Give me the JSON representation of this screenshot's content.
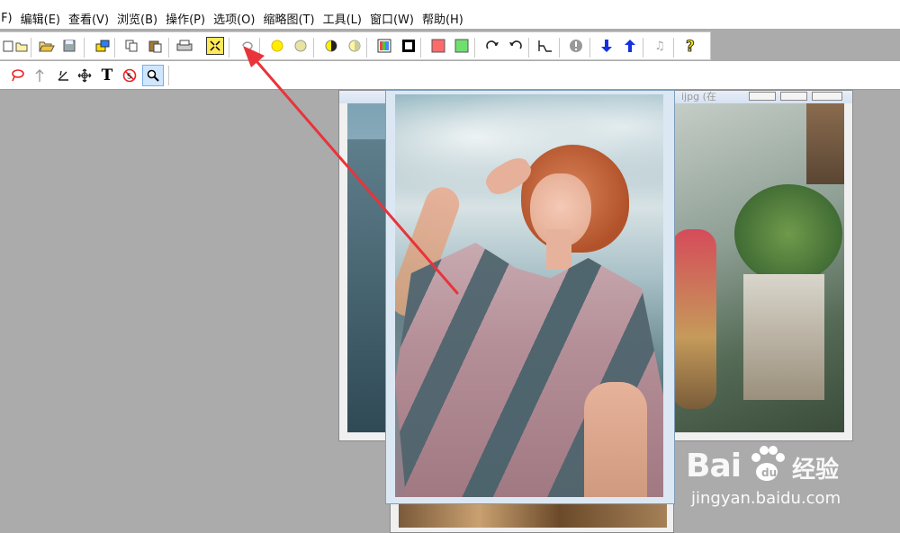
{
  "menu": [
    "(F)",
    "编辑(E)",
    "查看(V)",
    "浏览(B)",
    "操作(P)",
    "选项(O)",
    "缩略图(T)",
    "工具(L)",
    "窗口(W)",
    "帮助(H)"
  ],
  "toolbar1": [
    {
      "icon": "new-icon",
      "glyph": "▯"
    },
    {
      "icon": "folder-icon",
      "glyph": "🗀"
    },
    {
      "icon": "open-folder-icon",
      "glyph": "📂"
    },
    {
      "icon": "save-icon",
      "glyph": "💾"
    },
    {
      "icon": "color-pick-icon",
      "glyph": "🖌"
    },
    {
      "icon": "copy-icon",
      "glyph": "⧉"
    },
    {
      "icon": "paste-icon",
      "glyph": "📋"
    },
    {
      "icon": "print-icon",
      "glyph": "🖶"
    },
    {
      "icon": "fit-screen-icon",
      "glyph": "⛶"
    },
    {
      "icon": "lasso-icon",
      "glyph": "↶"
    },
    {
      "icon": "brightness-up-icon",
      "glyph": "☀"
    },
    {
      "icon": "brightness-down-icon",
      "glyph": "✺"
    },
    {
      "icon": "contrast-up-icon",
      "glyph": "◑"
    },
    {
      "icon": "contrast-down-icon",
      "glyph": "◐"
    },
    {
      "icon": "color-balance-icon",
      "glyph": "▦"
    },
    {
      "icon": "border-icon",
      "glyph": "▣"
    },
    {
      "icon": "red-fill-icon",
      "glyph": "■"
    },
    {
      "icon": "green-fill-icon",
      "glyph": "■"
    },
    {
      "icon": "rotate-right-icon",
      "glyph": "↷"
    },
    {
      "icon": "rotate-left-icon",
      "glyph": "↶"
    },
    {
      "icon": "histogram-icon",
      "glyph": "⊢"
    },
    {
      "icon": "info-icon",
      "glyph": "!"
    },
    {
      "icon": "arrow-down-icon",
      "glyph": "⬇"
    },
    {
      "icon": "arrow-up-icon",
      "glyph": "⬆"
    },
    {
      "icon": "music-icon",
      "glyph": "♫"
    },
    {
      "icon": "help-icon",
      "glyph": "?"
    }
  ],
  "toolbar2": [
    {
      "icon": "lasso-select-icon",
      "glyph": "ᑫ"
    },
    {
      "icon": "arrow-tool-icon",
      "glyph": "↑"
    },
    {
      "icon": "crop-tool-icon",
      "glyph": "⊿"
    },
    {
      "icon": "move-tool-icon",
      "glyph": "✥"
    },
    {
      "icon": "text-tool-icon",
      "glyph": "T"
    },
    {
      "icon": "red-eye-icon",
      "glyph": "⊘"
    },
    {
      "icon": "zoom-tool-icon",
      "glyph": "🔍"
    }
  ],
  "colors": {
    "background": "#ababab",
    "arrow": "#e8343a",
    "accent_blue": "#1430e0"
  },
  "watermark": {
    "brand_left": "Bai",
    "brand_right": "经验",
    "url": "jingyan.baidu.com"
  },
  "windows": {
    "back_title_partial": "ijpg (在"
  }
}
